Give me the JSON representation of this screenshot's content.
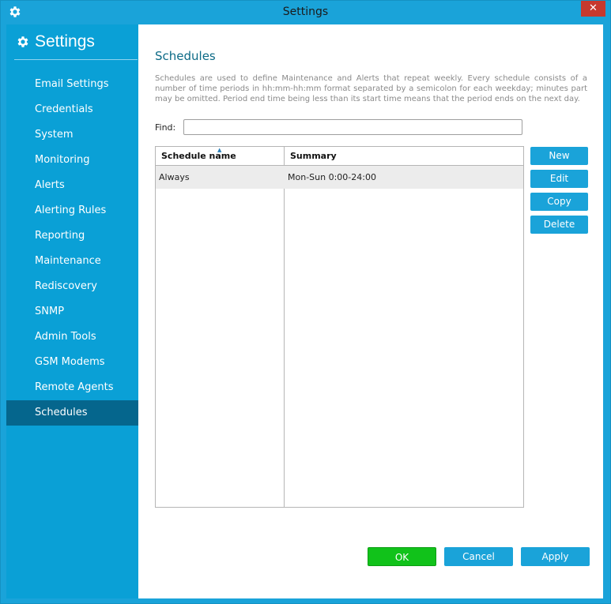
{
  "window": {
    "title": "Settings",
    "close_glyph": "✕",
    "icon": "gear-icon"
  },
  "sidebar": {
    "title": "Settings",
    "icon": "gear-icon",
    "items": [
      {
        "label": "Email Settings"
      },
      {
        "label": "Credentials"
      },
      {
        "label": "System"
      },
      {
        "label": "Monitoring"
      },
      {
        "label": "Alerts"
      },
      {
        "label": "Alerting Rules"
      },
      {
        "label": "Reporting"
      },
      {
        "label": "Maintenance"
      },
      {
        "label": "Rediscovery"
      },
      {
        "label": "SNMP"
      },
      {
        "label": "Admin Tools"
      },
      {
        "label": "GSM Modems"
      },
      {
        "label": "Remote Agents"
      },
      {
        "label": "Schedules",
        "active": true
      }
    ]
  },
  "content": {
    "heading": "Schedules",
    "description": "Schedules are used to define Maintenance and Alerts that repeat weekly. Every schedule consists of a number of time periods in hh:mm-hh:mm format separated by a semicolon for each weekday; minutes part may be omitted. Period end time being less than its start time means that the period ends on the next day.",
    "find": {
      "label": "Find:",
      "value": "",
      "placeholder": ""
    },
    "table": {
      "columns": [
        "Schedule name",
        "Summary"
      ],
      "sort_glyph": "▲",
      "rows": [
        {
          "name": "Always",
          "summary": "Mon-Sun 0:00-24:00"
        }
      ]
    },
    "actions": {
      "new": "New",
      "edit": "Edit",
      "copy": "Copy",
      "delete": "Delete"
    },
    "footer": {
      "ok": "OK",
      "cancel": "Cancel",
      "apply": "Apply"
    }
  },
  "colors": {
    "accent": "#1aa3d9",
    "sidebar_active": "#05668d",
    "ok_green": "#11c21a",
    "heading": "#0c6a86",
    "close_red": "#c7392e"
  }
}
